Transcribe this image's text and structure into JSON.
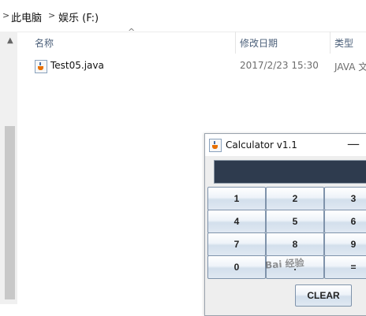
{
  "breadcrumb": {
    "items": [
      "此电脑",
      "娱乐 (F:)"
    ]
  },
  "file_list": {
    "columns": [
      "名称",
      "修改日期",
      "类型"
    ],
    "rows": [
      {
        "name": "Test05.java",
        "modified": "2017/2/23 15:30",
        "type": "JAVA 文"
      }
    ]
  },
  "calculator": {
    "title": "Calculator v1.1",
    "minimize_glyph": "—",
    "display_value": "",
    "keys": [
      "1",
      "2",
      "3",
      "4",
      "5",
      "6",
      "7",
      "8",
      "9",
      "0",
      ".",
      "="
    ],
    "clear_label": "CLEAR",
    "colors": {
      "display_bg": "#2e3b4e",
      "button_border": "#7f93ab"
    }
  },
  "watermark": {
    "text": "Bai 经验"
  },
  "icons": [
    "chevron-right-icon",
    "java-file-icon",
    "sort-up-icon",
    "java-app-icon"
  ]
}
